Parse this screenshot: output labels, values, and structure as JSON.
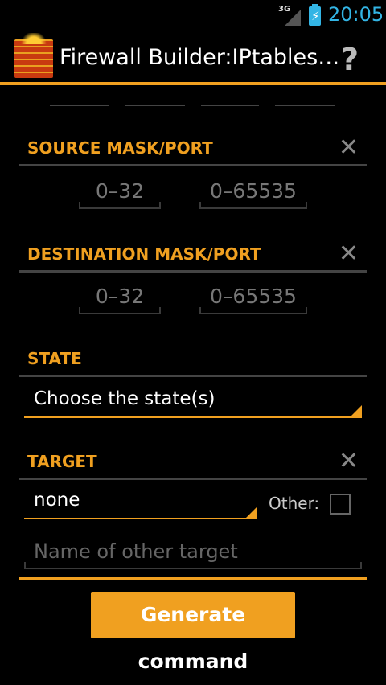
{
  "status_bar": {
    "network": "3G",
    "time": "20:05"
  },
  "action_bar": {
    "title": "Firewall Builder:IPtables…",
    "help_glyph": "?",
    "icon": "brick-wall-fire-icon"
  },
  "source": {
    "header": "SOURCE MASK/PORT",
    "clear_glyph": "✕",
    "mask_placeholder": "0–32",
    "port_placeholder": "0–65535"
  },
  "destination": {
    "header": "DESTINATION MASK/PORT",
    "clear_glyph": "✕",
    "mask_placeholder": "0–32",
    "port_placeholder": "0–65535"
  },
  "state": {
    "header": "STATE",
    "spinner_value": "Choose the state(s)"
  },
  "target": {
    "header": "TARGET",
    "clear_glyph": "✕",
    "spinner_value": "none",
    "other_label": "Other:",
    "other_checked": false,
    "other_placeholder": "Name of other target"
  },
  "actions": {
    "generate_label": "Generate command"
  },
  "colors": {
    "accent": "#f0a020",
    "status_blue": "#33b5e5",
    "background": "#000000"
  }
}
